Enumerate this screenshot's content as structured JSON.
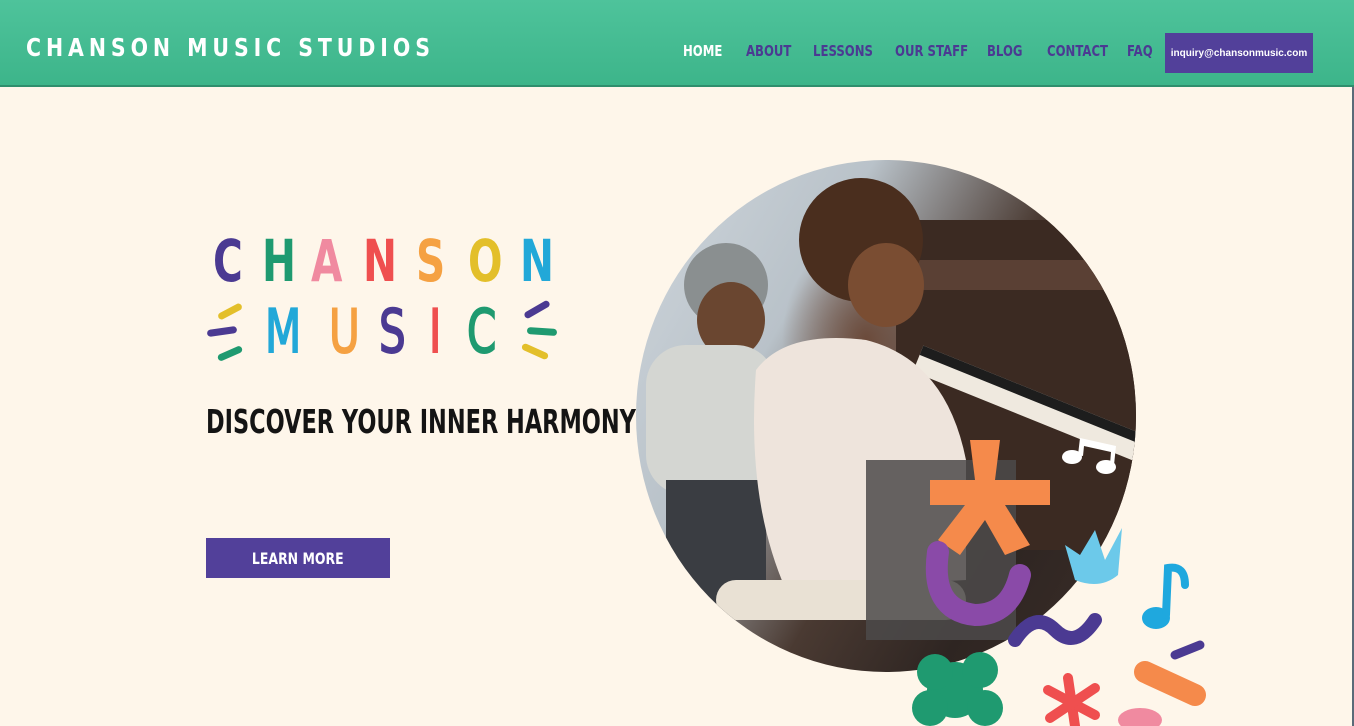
{
  "header": {
    "brand": "CHANSON MUSIC STUDIOS",
    "nav": [
      {
        "label": "HOME",
        "active": true
      },
      {
        "label": "ABOUT",
        "active": false
      },
      {
        "label": "LESSONS",
        "active": false
      },
      {
        "label": "OUR STAFF",
        "active": false
      },
      {
        "label": "BLOG",
        "active": false
      },
      {
        "label": "CONTACT",
        "active": false
      },
      {
        "label": "FAQ",
        "active": false
      }
    ],
    "email_button": "inquiry@chansonmusic.com"
  },
  "hero": {
    "logo_word_1": [
      "C",
      "H",
      "A",
      "N",
      "S",
      "O",
      "N"
    ],
    "logo_word_2": [
      "M",
      "U",
      "S",
      "I",
      "C"
    ],
    "tagline": "DISCOVER YOUR INNER HARMONY",
    "cta_label": "LEARN MORE"
  },
  "colors": {
    "header_green": "#3db58a",
    "purple": "#52409a",
    "background": "#fef6ea",
    "logo_word_1": [
      "#4b3a92",
      "#1f9a70",
      "#f08aa0",
      "#ef4f4f",
      "#f5a142",
      "#e3bf2a",
      "#22a8d8"
    ],
    "logo_word_2": [
      "#22a8d8",
      "#f5a142",
      "#4b3a92",
      "#ef4f4f",
      "#1f9a70"
    ]
  },
  "icons": [
    "music-note-icon",
    "asterisk-shape",
    "flower-shape"
  ]
}
